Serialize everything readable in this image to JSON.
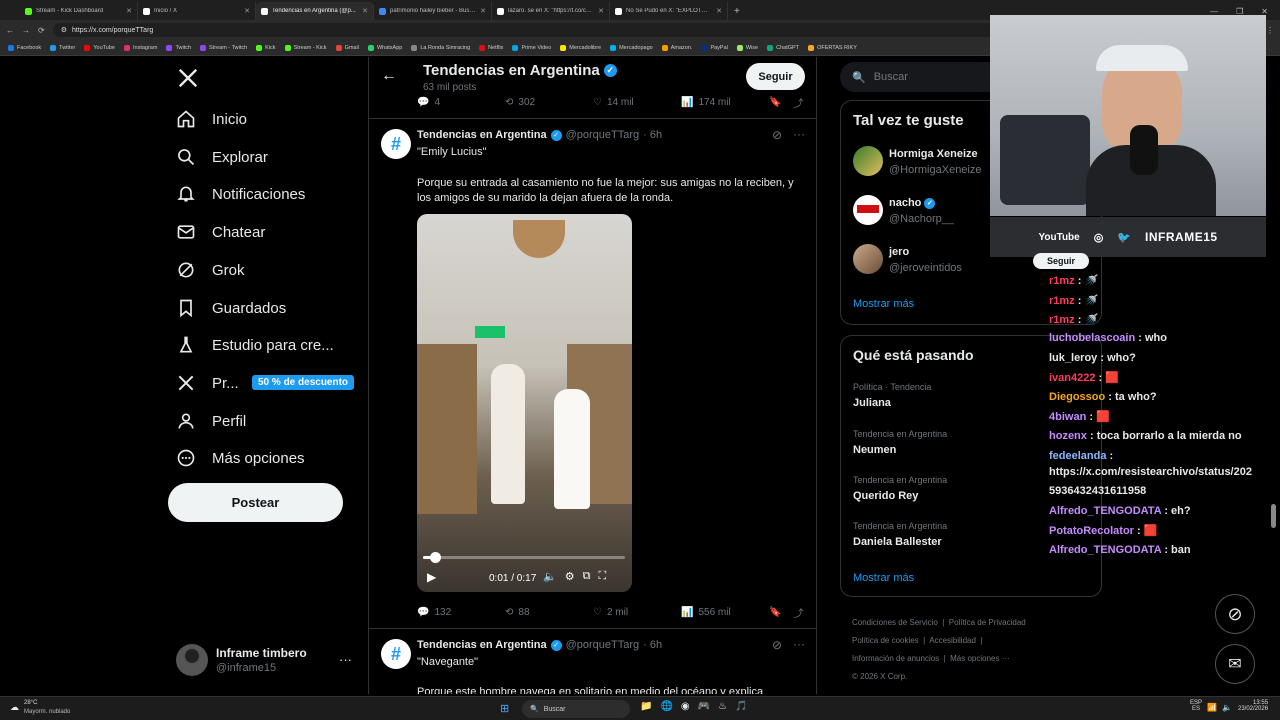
{
  "browser": {
    "tabs": [
      {
        "title": "Stream - Kick Dashboard",
        "color": "#53fc18",
        "close": "✕"
      },
      {
        "title": "Inicio / X",
        "color": "#000000",
        "close": "✕"
      },
      {
        "title": "Tendencias en Argentina (@p...",
        "color": "#000000",
        "close": "✕"
      },
      {
        "title": "patrimonio hailey bieber - Buscar",
        "color": "#4285f4",
        "close": "✕"
      },
      {
        "title": "lázaro. se en X: \"https://t.co/cywH...",
        "color": "#000000",
        "close": "✕"
      },
      {
        "title": "No Se Pudo en X: \"EXPLOTÓ ERN...",
        "color": "#000000",
        "close": "✕"
      }
    ],
    "new_tab": "+",
    "url": "https://x.com/porqueTTarg",
    "bookmarks": [
      "Facebook",
      "Twitter",
      "YouTube",
      "Instagram",
      "Twitch",
      "Stream - Twitch",
      "Kick",
      "Stream - Kick",
      "Gmail",
      "WhatsApp",
      "La Ronda Simracing",
      "Netflix",
      "Prime Video",
      "Mercadolibre",
      "Mercadopago",
      "Amazon.",
      "PayPal",
      "Wise",
      "ChatGPT",
      "OFERTAS RIKY"
    ]
  },
  "nav": {
    "items": [
      {
        "label": "Inicio",
        "icon": "home-icon"
      },
      {
        "label": "Explorar",
        "icon": "search-icon"
      },
      {
        "label": "Notificaciones",
        "icon": "bell-icon"
      },
      {
        "label": "Chatear",
        "icon": "mail-icon"
      },
      {
        "label": "Grok",
        "icon": "grok-icon"
      },
      {
        "label": "Guardados",
        "icon": "bookmark-icon"
      },
      {
        "label": "Estudio para cre...",
        "icon": "flask-icon"
      },
      {
        "label": "Pr...",
        "icon": "x-logo-icon"
      },
      {
        "label": "Perfil",
        "icon": "person-icon"
      },
      {
        "label": "Más opciones",
        "icon": "more-circle-icon"
      }
    ],
    "premium_badge": "50 % de descuento",
    "post_button": "Postear",
    "account": {
      "name": "Inframe timbero",
      "handle": "@inframe15",
      "more": "···"
    }
  },
  "header": {
    "title": "Tendencias en Argentina",
    "posts": "63 mil posts",
    "follow": "Seguir"
  },
  "prev_actions": {
    "replies": "4",
    "reposts": "302",
    "likes": "14 mil",
    "views": "174 mil"
  },
  "tweet1": {
    "name": "Tendencias en Argentina",
    "handle": "@porqueTTarg",
    "time": "· 6h",
    "quote": "\"Emily Lucius\"",
    "body": "Porque su entrada al casamiento no fue la mejor: sus amigas no la reciben, y los amigos de su marido la dejan afuera de la ronda.",
    "video_time": "0:01 / 0:17",
    "video_progress": 0.06,
    "actions": {
      "replies": "132",
      "reposts": "88",
      "likes": "2 mil",
      "views": "556 mil"
    }
  },
  "tweet2": {
    "name": "Tendencias en Argentina",
    "handle": "@porqueTTarg",
    "time": "· 6h",
    "quote": "\"Navegante\"",
    "body": "Porque este hombre navega en solitario en medio del océano y explica"
  },
  "search": {
    "placeholder": "Buscar"
  },
  "suggest": {
    "title": "Tal vez te guste",
    "users": [
      {
        "name": "Hormiga Xeneize",
        "handle": "@HormigaXeneize",
        "verified": false
      },
      {
        "name": "nacho",
        "handle": "@Nachorp__",
        "verified": true
      },
      {
        "name": "jero",
        "handle": "@jeroveintidos",
        "verified": false
      }
    ],
    "follow": "Seguir",
    "more": "Mostrar más"
  },
  "trends": {
    "title": "Qué está pasando",
    "items": [
      {
        "context": "Política · Tendencia",
        "name": "Juliana"
      },
      {
        "context": "Tendencia en Argentina",
        "name": "Neumen"
      },
      {
        "context": "Tendencia en Argentina",
        "name": "Querido Rey"
      },
      {
        "context": "Tendencia en Argentina",
        "name": "Daniela Ballester"
      }
    ],
    "more": "Mostrar más"
  },
  "footer": {
    "links": [
      "Condiciones de Servicio",
      "Política de Privacidad",
      "Política de cookies",
      "Accesibilidad",
      "Información de anuncios",
      "Más opciones ···"
    ],
    "copyright": "© 2026 X Corp."
  },
  "stream": {
    "youtube": "YouTube",
    "brand": "INFRAME15"
  },
  "chat": [
    {
      "user": "r1mz",
      "msg": ": 🚿",
      "color": "#ff3b5c"
    },
    {
      "user": "r1mz",
      "msg": ": 🚿",
      "color": "#ff3b5c"
    },
    {
      "user": "r1mz",
      "msg": ": 🚿",
      "color": "#ff3b5c"
    },
    {
      "user": "luchobelascoain",
      "msg": ": who",
      "color": "#c58cff"
    },
    {
      "user": "luk_leroy",
      "msg": ": who?",
      "color": "#e7e9ea"
    },
    {
      "user": "ivan4222",
      "msg": ": 🟥",
      "color": "#ff3b5c"
    },
    {
      "user": "Diegossoo",
      "msg": ": ta who?",
      "color": "#f5a623"
    },
    {
      "user": "4biwan",
      "msg": ": 🟥",
      "color": "#c58cff"
    },
    {
      "user": "hozenx",
      "msg": ": toca borrarlo a la mierda no",
      "color": "#c58cff"
    },
    {
      "user": "fedeelanda",
      "msg": ":",
      "color": "#8cb8ff"
    },
    {
      "user": "",
      "msg": "https://x.com/resistearchivo/status/202",
      "color": "#e7e9ea"
    },
    {
      "user": "",
      "msg": "5936432431611958",
      "color": "#e7e9ea"
    },
    {
      "user": "Alfredo_TENGODATA",
      "msg": ": eh?",
      "color": "#c58cff"
    },
    {
      "user": "PotatoRecolator",
      "msg": ": 🟥",
      "color": "#c58cff"
    },
    {
      "user": "Alfredo_TENGODATA",
      "msg": ": ban",
      "color": "#c58cff"
    }
  ],
  "taskbar": {
    "weather_temp": "28°C",
    "weather_desc": "Mayorm. nublado",
    "search": "Buscar",
    "lang": "ESP",
    "lang2": "ES",
    "time": "13:55",
    "date": "23/02/2026"
  }
}
